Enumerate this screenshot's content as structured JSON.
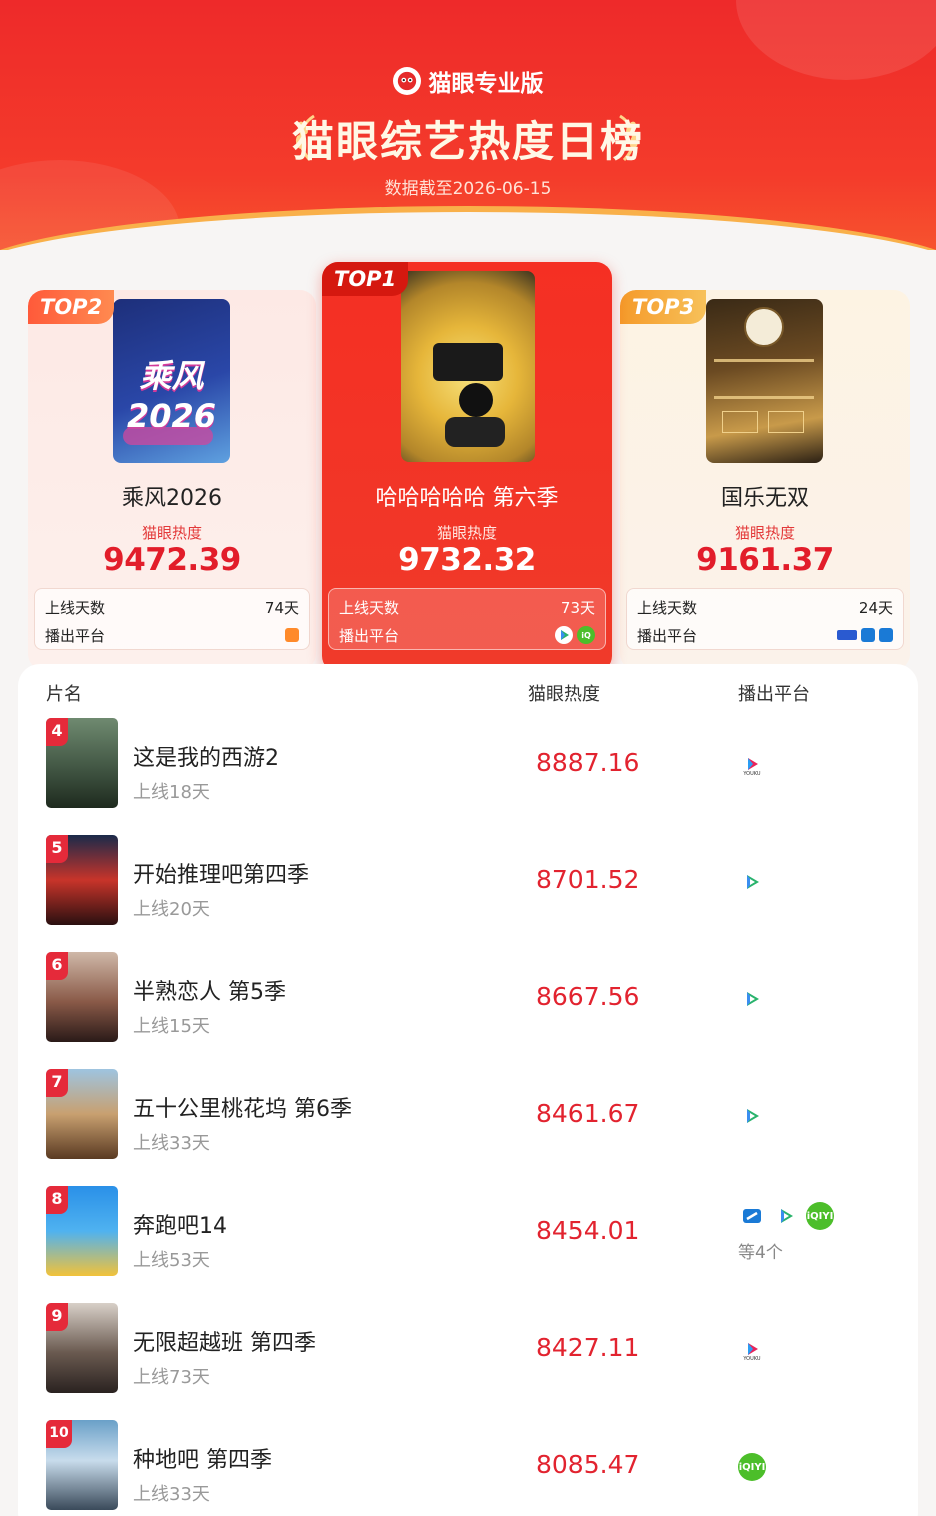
{
  "header": {
    "brand": "猫眼专业版",
    "title": "猫眼综艺热度日榜",
    "date_line": "数据截至2026-06-15"
  },
  "top": [
    {
      "rank_label": "TOP1",
      "name": "哈哈哈哈哈 第六季",
      "heat_label": "猫眼热度",
      "heat": "9732.32",
      "days_label": "上线天数",
      "days": "73天",
      "platform_label": "播出平台",
      "platforms": [
        "tencent-video-icon",
        "iqiyi-icon"
      ]
    },
    {
      "rank_label": "TOP2",
      "name": "乘风2026",
      "heat_label": "猫眼热度",
      "heat": "9472.39",
      "days_label": "上线天数",
      "days": "74天",
      "platform_label": "播出平台",
      "platforms": [
        "mango-tv-icon"
      ],
      "poster_text": "乘风 2026"
    },
    {
      "rank_label": "TOP3",
      "name": "国乐无双",
      "heat_label": "猫眼热度",
      "heat": "9161.37",
      "days_label": "上线天数",
      "days": "24天",
      "platform_label": "播出平台",
      "platforms": [
        "cctv6-icon",
        "zhejiang-tv-icon",
        "zhejiang-tv-icon"
      ]
    }
  ],
  "list": {
    "headers": {
      "name": "片名",
      "heat": "猫眼热度",
      "platform": "播出平台"
    },
    "rows": [
      {
        "rank": "4",
        "name": "这是我的西游2",
        "days": "上线18天",
        "heat": "8887.16",
        "platforms": [
          "youku-icon"
        ]
      },
      {
        "rank": "5",
        "name": "开始推理吧第四季",
        "days": "上线20天",
        "heat": "8701.52",
        "platforms": [
          "tencent-video-icon"
        ]
      },
      {
        "rank": "6",
        "name": "半熟恋人 第5季",
        "days": "上线15天",
        "heat": "8667.56",
        "platforms": [
          "tencent-video-icon"
        ]
      },
      {
        "rank": "7",
        "name": "五十公里桃花坞 第6季",
        "days": "上线33天",
        "heat": "8461.67",
        "platforms": [
          "tencent-video-icon"
        ]
      },
      {
        "rank": "8",
        "name": "奔跑吧14",
        "days": "上线53天",
        "heat": "8454.01",
        "platforms": [
          "zhejiang-tv-icon",
          "tencent-video-icon",
          "iqiyi-icon"
        ],
        "more": "等4个"
      },
      {
        "rank": "9",
        "name": "无限超越班 第四季",
        "days": "上线73天",
        "heat": "8427.11",
        "platforms": [
          "youku-icon"
        ]
      },
      {
        "rank": "10",
        "name": "种地吧 第四季",
        "days": "上线33天",
        "heat": "8085.47",
        "platforms": [
          "iqiyi-icon"
        ]
      }
    ]
  },
  "colors": {
    "accent_red": "#e2232f",
    "header_red": "#f03a2a",
    "gold": "#f9b04a"
  }
}
